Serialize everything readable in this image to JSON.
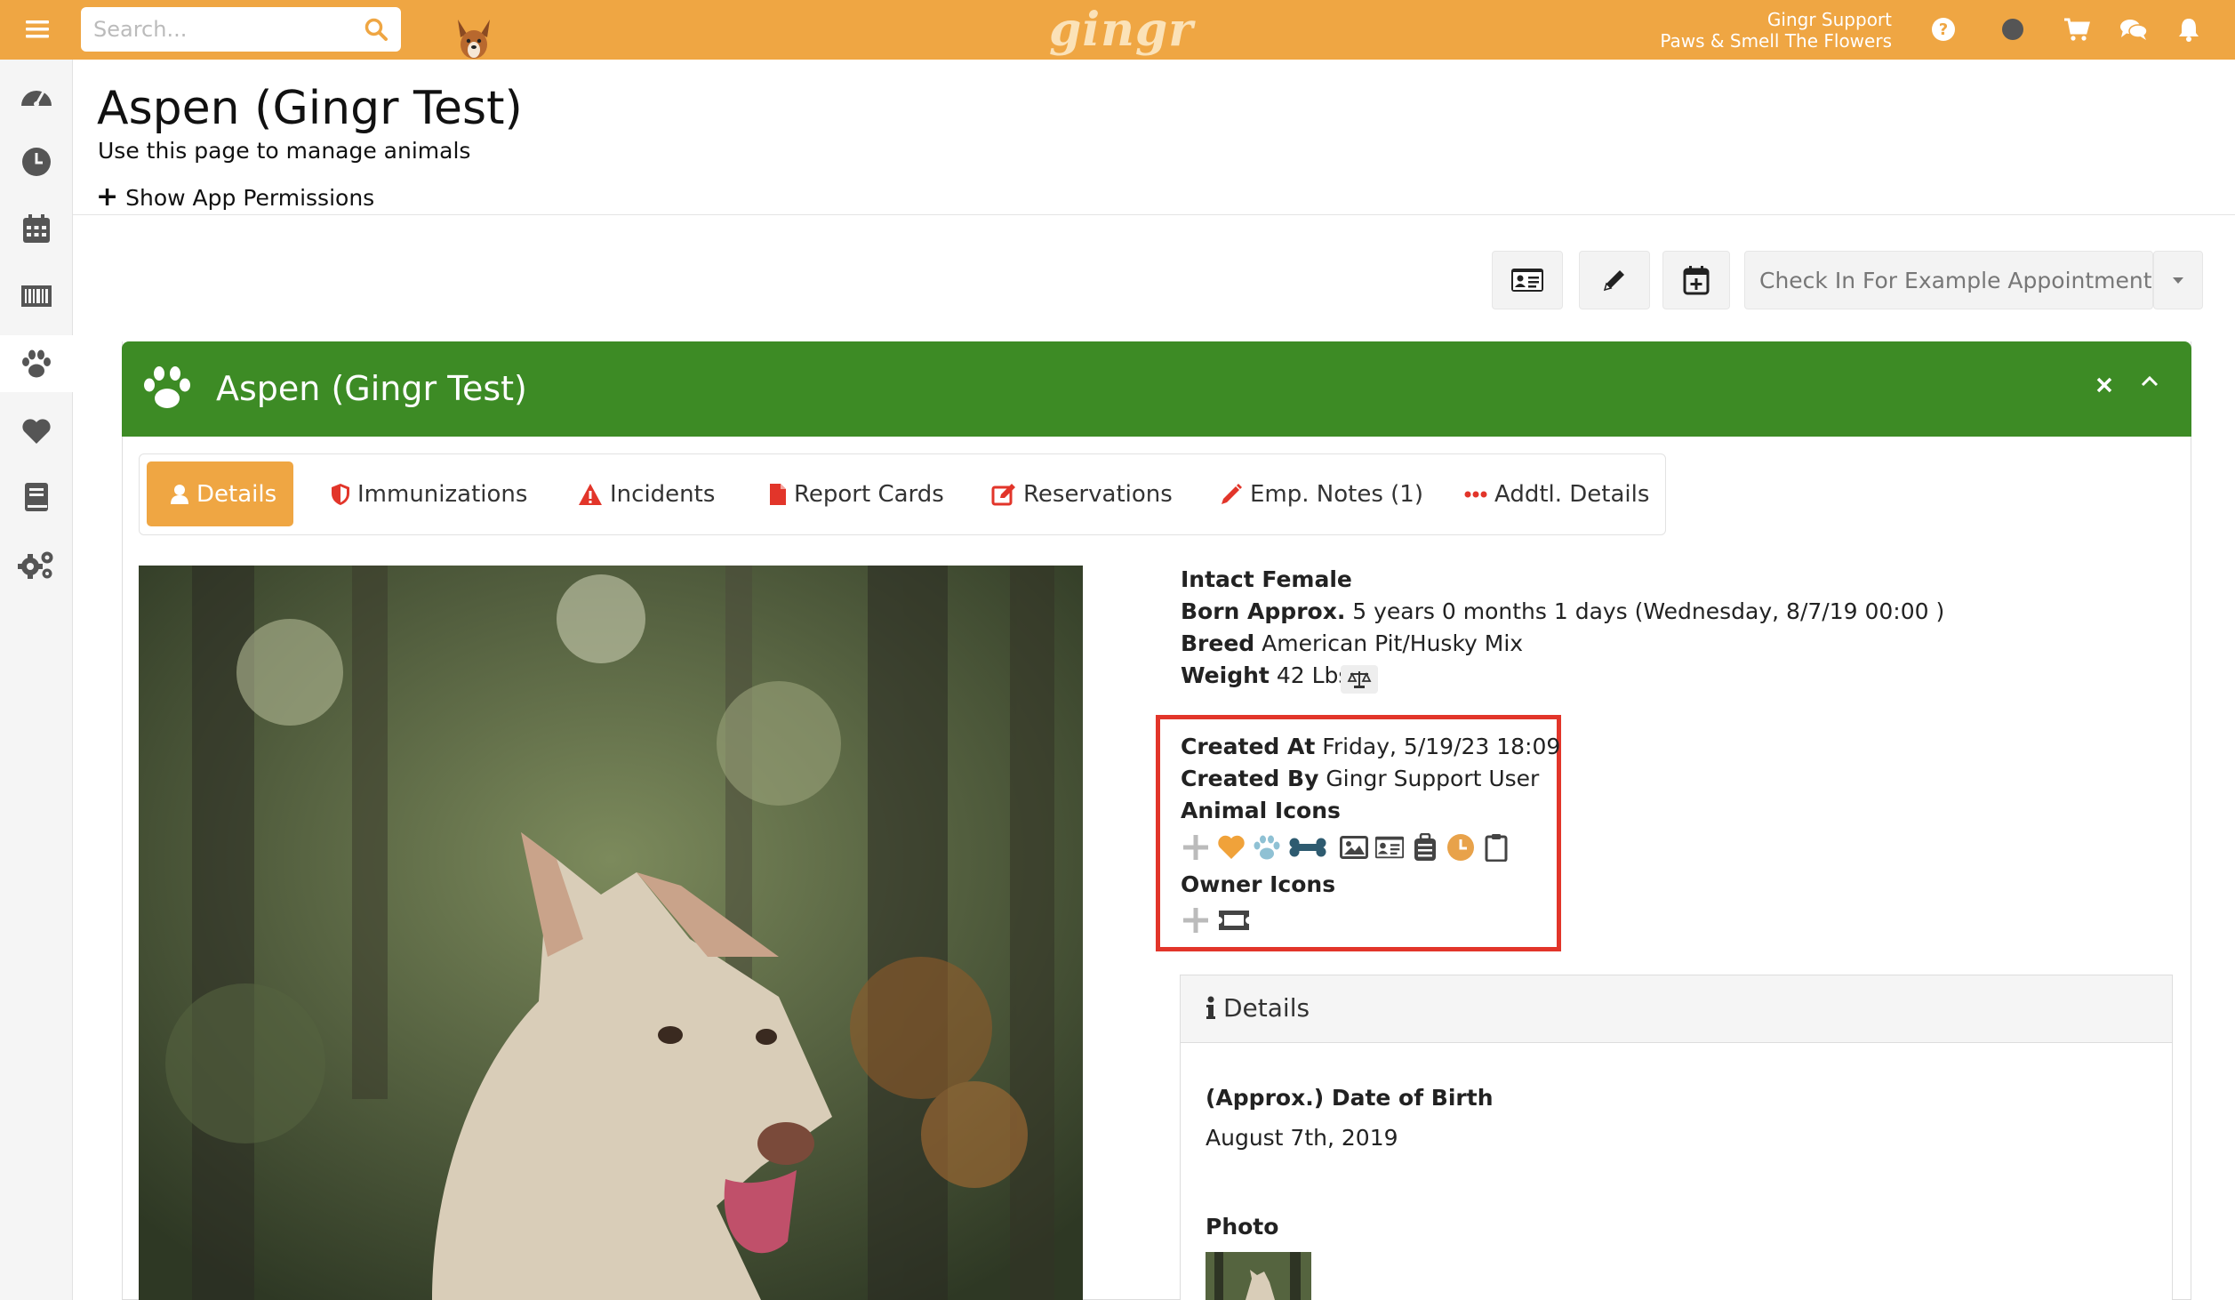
{
  "topbar": {
    "search_placeholder": "Search...",
    "user_name": "Gingr Support",
    "business_name": "Paws & Smell The Flowers",
    "brand_color": "#efa643",
    "logo_alt": "gingr"
  },
  "sidebar": {
    "items": [
      {
        "icon": "dashboard-icon"
      },
      {
        "icon": "clock-icon"
      },
      {
        "icon": "calendar-icon"
      },
      {
        "icon": "barcode-icon"
      },
      {
        "icon": "paw-icon",
        "active": true
      },
      {
        "icon": "heart-icon"
      },
      {
        "icon": "book-icon"
      },
      {
        "icon": "gears-icon"
      }
    ]
  },
  "page": {
    "title": "Aspen (Gingr Test)",
    "subtitle": "Use this page to manage animals",
    "permissions_toggle": "Show App Permissions"
  },
  "actions": {
    "checkin_label": "Check In For Example Appointment"
  },
  "panel": {
    "title": "Aspen (Gingr Test)",
    "header_color": "#3d8b25"
  },
  "tabs": [
    {
      "label": "Details",
      "icon": "user-icon",
      "active": true
    },
    {
      "label": "Immunizations",
      "icon": "shield-icon"
    },
    {
      "label": "Incidents",
      "icon": "warning-icon"
    },
    {
      "label": "Report Cards",
      "icon": "file-icon"
    },
    {
      "label": "Reservations",
      "icon": "edit-icon"
    },
    {
      "label": "Emp. Notes (1)",
      "icon": "pencil-icon"
    },
    {
      "label": "Addtl. Details",
      "icon": "ellipsis-icon"
    }
  ],
  "info": {
    "sex": "Intact Female",
    "born_label": "Born Approx.",
    "born_value": "5 years 0 months 1 days (Wednesday, 8/7/19 00:00 )",
    "breed_label": "Breed",
    "breed_value": "American Pit/Husky Mix",
    "weight_label": "Weight",
    "weight_value": "42 Lbs",
    "created_at_label": "Created At",
    "created_at_value": "Friday, 5/19/23 18:09",
    "created_by_label": "Created By",
    "created_by_value": "Gingr Support User",
    "animal_icons_label": "Animal Icons",
    "owner_icons_label": "Owner Icons"
  },
  "details_card": {
    "title": "Details",
    "dob_label": "(Approx.) Date of Birth",
    "dob_value": "August 7th, 2019",
    "photo_label": "Photo"
  }
}
